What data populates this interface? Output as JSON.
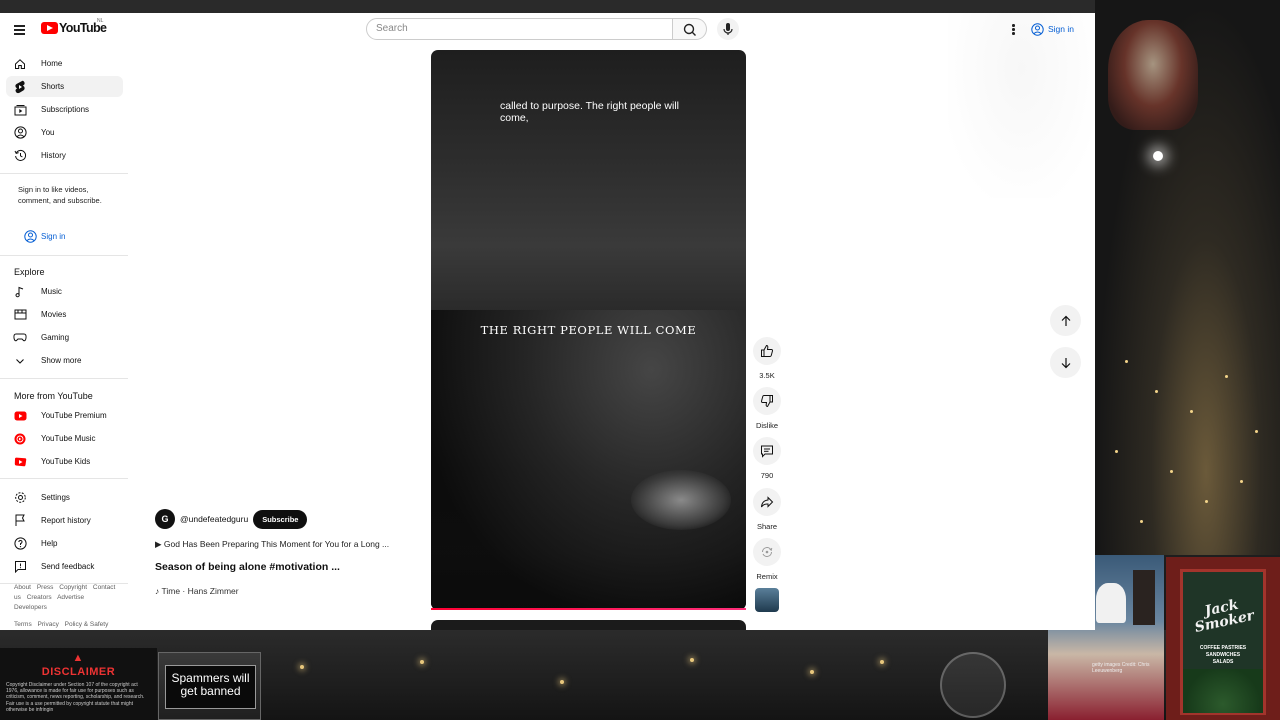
{
  "masthead": {
    "logo_text": "YouTube",
    "region_code": "NL",
    "search_placeholder": "Search",
    "signin_label": "Sign in"
  },
  "sidebar": {
    "main_items": [
      {
        "label": "Home",
        "icon": "home-icon"
      },
      {
        "label": "Shorts",
        "icon": "shorts-icon"
      },
      {
        "label": "Subscriptions",
        "icon": "subscriptions-icon"
      },
      {
        "label": "You",
        "icon": "you-icon"
      },
      {
        "label": "History",
        "icon": "history-icon"
      }
    ],
    "signin_prompt": "Sign in to like videos, comment, and subscribe.",
    "signin_label": "Sign in",
    "explore_title": "Explore",
    "explore_items": [
      {
        "label": "Music",
        "icon": "music-note-icon"
      },
      {
        "label": "Movies",
        "icon": "movies-icon"
      },
      {
        "label": "Gaming",
        "icon": "gaming-icon"
      },
      {
        "label": "Show more",
        "icon": "chevron-down-icon"
      }
    ],
    "more_title": "More from YouTube",
    "more_items": [
      {
        "label": "YouTube Premium",
        "icon": "youtube-premium-icon"
      },
      {
        "label": "YouTube Music",
        "icon": "youtube-music-icon"
      },
      {
        "label": "YouTube Kids",
        "icon": "youtube-kids-icon"
      }
    ],
    "settings_items": [
      {
        "label": "Settings",
        "icon": "gear-icon"
      },
      {
        "label": "Report history",
        "icon": "flag-icon"
      },
      {
        "label": "Help",
        "icon": "help-icon"
      },
      {
        "label": "Send feedback",
        "icon": "feedback-icon"
      }
    ],
    "footer_row1": [
      "About",
      "Press",
      "Copyright",
      "Contact us",
      "Creators",
      "Advertise",
      "Developers"
    ],
    "footer_row2": [
      "Terms",
      "Privacy",
      "Policy & Safety"
    ]
  },
  "short": {
    "caption": "called to purpose. The right people will come,",
    "overlay_title": "THE RIGHT PEOPLE WILL COME",
    "progress_fraction": 1.0,
    "channel_avatar_letter": "G",
    "channel_handle": "@undefeatedguru",
    "subscribe_label": "Subscribe",
    "related_text": "God Has Been Preparing This Moment for You for a Long ...",
    "title": "Season of being alone #motivation ...",
    "music": "Time · Hans Zimmer"
  },
  "actions": {
    "like_count": "3.5K",
    "dislike_label": "Dislike",
    "comment_count": "790",
    "share_label": "Share",
    "remix_label": "Remix"
  },
  "overlays": {
    "disclaimer_title": "DISCLAIMER",
    "disclaimer_body": "Copyright Disclaimer under Section 107 of the copyright act 1976, allowance is made for fair use for purposes such as criticism, comment, news reporting, scholarship, and research. Fair use is a use permitted by copyright statute that might otherwise be infringin",
    "spam_sign": "Spammers will get banned",
    "shop_brand": "Jack Smoker",
    "shop_menu": "COFFEE PASTRIES SANDWICHES SALADS",
    "camera_credit": "getty images Credit: Chris Leeuwenberg"
  }
}
